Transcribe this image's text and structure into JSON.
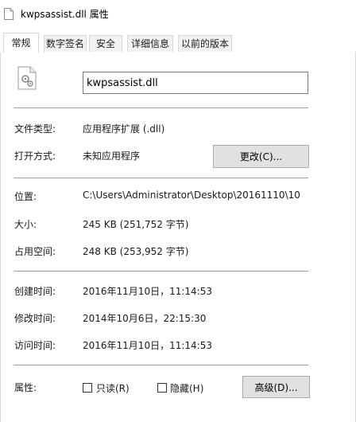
{
  "window": {
    "title": "kwpsassist.dll 属性"
  },
  "tabs": [
    {
      "label": "常规",
      "active": true
    },
    {
      "label": "数字签名",
      "active": false
    },
    {
      "label": "安全",
      "active": false
    },
    {
      "label": "详细信息",
      "active": false
    },
    {
      "label": "以前的版本",
      "active": false
    }
  ],
  "general": {
    "file_name": "kwpsassist.dll",
    "file_type": {
      "label": "文件类型:",
      "value": "应用程序扩展 (.dll)"
    },
    "opens_with": {
      "label": "打开方式:",
      "value": "未知应用程序",
      "change_button": "更改(C)..."
    },
    "location": {
      "label": "位置:",
      "value": "C:\\Users\\Administrator\\Desktop\\20161110\\10"
    },
    "size": {
      "label": "大小:",
      "value": "245 KB (251,752 字节)"
    },
    "size_on_disk": {
      "label": "占用空间:",
      "value": "248 KB (253,952 字节)"
    },
    "created": {
      "label": "创建时间:",
      "value": "2016年11月10日，11:14:53"
    },
    "modified": {
      "label": "修改时间:",
      "value": "2014年10月6日，22:15:30"
    },
    "accessed": {
      "label": "访问时间:",
      "value": "2016年11月10日，11:14:53"
    },
    "attributes": {
      "label": "属性:",
      "readonly": {
        "label": "只读(R)",
        "checked": false
      },
      "hidden": {
        "label": "隐藏(H)",
        "checked": false
      },
      "advanced_button": "高级(D)..."
    }
  }
}
